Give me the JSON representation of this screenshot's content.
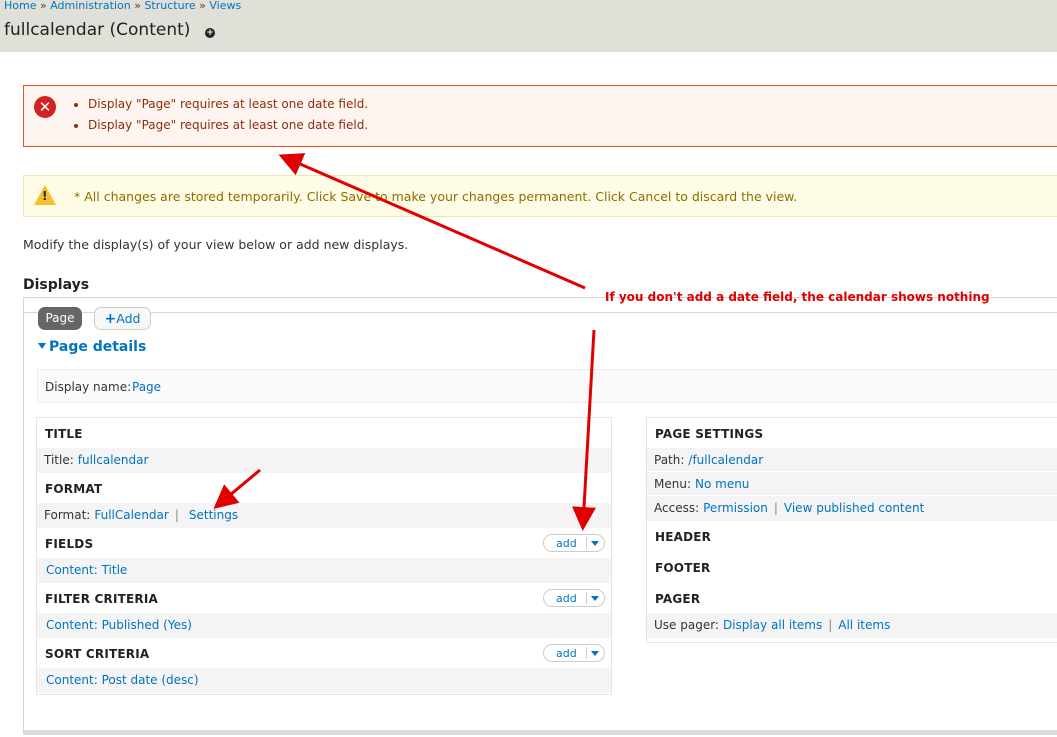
{
  "breadcrumb": {
    "home": "Home",
    "sep": "»",
    "administration": "Administration",
    "structure": "Structure",
    "views": "Views"
  },
  "page_title": "fullcalendar (Content)",
  "messages": {
    "errors": [
      "Display \"Page\" requires at least one date field.",
      "Display \"Page\" requires at least one date field."
    ],
    "warning": "* All changes are stored temporarily. Click Save to make your changes permanent. Click Cancel to discard the view."
  },
  "intro": "Modify the display(s) of your view below or add new displays.",
  "displays_heading": "Displays",
  "tabs": {
    "page": "Page",
    "add": "Add"
  },
  "details_toggle": "Page details",
  "display_name": {
    "label": "Display name:",
    "value": "Page"
  },
  "left": {
    "title": {
      "heading": "TITLE",
      "label": "Title:",
      "value": "fullcalendar"
    },
    "format": {
      "heading": "FORMAT",
      "label": "Format:",
      "value": "FullCalendar",
      "settings": "Settings"
    },
    "fields": {
      "heading": "FIELDS",
      "item": "Content: Title"
    },
    "filter": {
      "heading": "FILTER CRITERIA",
      "item": "Content: Published (Yes)"
    },
    "sort": {
      "heading": "SORT CRITERIA",
      "item": "Content: Post date (desc)"
    },
    "add_label": "add"
  },
  "right": {
    "page_settings": {
      "heading": "PAGE SETTINGS",
      "path_label": "Path:",
      "path_value": "/fullcalendar",
      "menu_label": "Menu:",
      "menu_value": "No menu",
      "access_label": "Access:",
      "access_value": "Permission",
      "view_published": "View published content"
    },
    "header": "HEADER",
    "footer": "FOOTER",
    "pager": {
      "heading": "PAGER",
      "label": "Use pager:",
      "value": "Display all items",
      "items": "All items"
    }
  },
  "annotation": "If you don't add a date field, the calendar shows nothing",
  "colors": {
    "annotation": "#e00000",
    "link": "#0074bd",
    "error_border": "#ed541d",
    "header_bg": "#e0e0d8"
  }
}
